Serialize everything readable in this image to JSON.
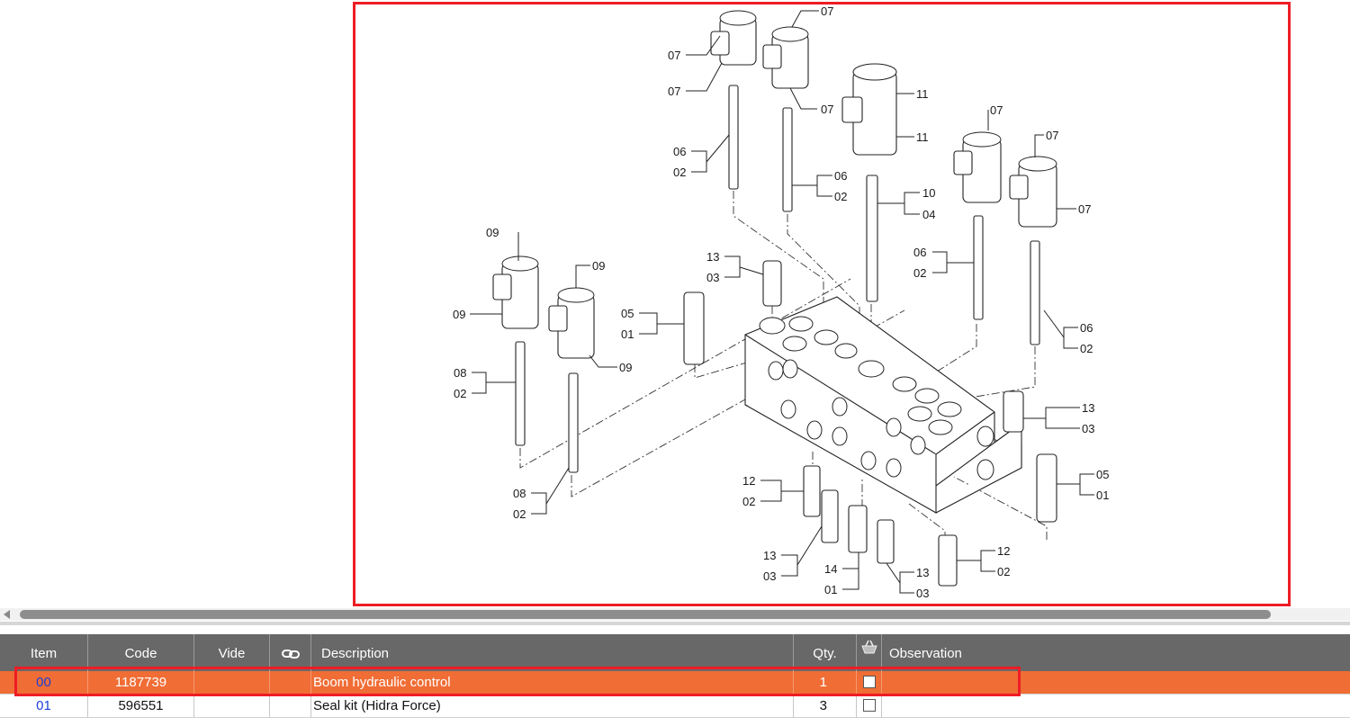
{
  "diagram": {
    "callouts": [
      "07",
      "07",
      "07",
      "07",
      "11",
      "11",
      "06",
      "02",
      "06",
      "02",
      "10",
      "04",
      "07",
      "07",
      "07",
      "09",
      "09",
      "09",
      "09",
      "13",
      "03",
      "05",
      "01",
      "06",
      "02",
      "06",
      "02",
      "08",
      "02",
      "08",
      "02",
      "13",
      "03",
      "12",
      "02",
      "05",
      "01",
      "13",
      "03",
      "14",
      "01",
      "13",
      "03",
      "12",
      "02"
    ]
  },
  "table": {
    "headers": {
      "item": "Item",
      "code": "Code",
      "vide": "Vide",
      "description": "Description",
      "qty": "Qty.",
      "observation": "Observation"
    },
    "header_icons": [
      "link-icon",
      "cart-icon"
    ],
    "rows": [
      {
        "item": "00",
        "code": "1187739",
        "vide": "",
        "description": "Boom hydraulic control",
        "qty": "1",
        "observation": "",
        "selected": true
      },
      {
        "item": "01",
        "code": "596551",
        "vide": "",
        "description": "Seal kit (Hidra Force)",
        "qty": "3",
        "observation": "",
        "selected": false
      }
    ]
  },
  "colors": {
    "highlight_border": "#ee1c25",
    "selected_row": "#f06d35",
    "header_bg": "#686868",
    "item_link": "#1c3fd8"
  }
}
